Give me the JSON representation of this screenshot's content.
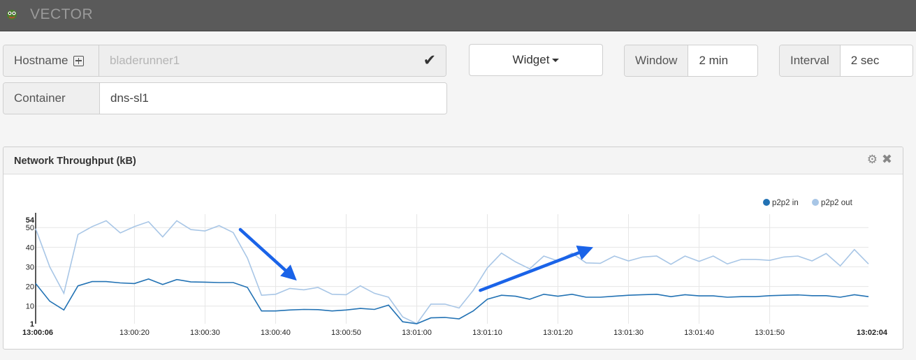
{
  "app": {
    "brand": "VECTOR",
    "logo_icon": "vector-logo-icon"
  },
  "hostname": {
    "label": "Hostname",
    "value": "bladerunner1",
    "add_icon": "plus-square-icon",
    "confirm_icon": "check-icon"
  },
  "container": {
    "label": "Container",
    "value": "dns-sl1"
  },
  "widget_button": {
    "label": "Widget"
  },
  "window": {
    "label": "Window",
    "value": "2 min"
  },
  "interval": {
    "label": "Interval",
    "value": "2 sec"
  },
  "panel": {
    "title": "Network Throughput (kB)",
    "settings_icon": "gear-icon",
    "close_icon": "close-icon"
  },
  "colors": {
    "in": "#2272b4",
    "out": "#a8c6e6",
    "arrow": "#1a63e8"
  },
  "chart_data": {
    "type": "line",
    "title": "Network Throughput (kB)",
    "x_start_label": "13:00:06",
    "x_end_label": "13:02:04",
    "x_tick_labels": [
      "13:00:20",
      "13:00:30",
      "13:00:40",
      "13:00:50",
      "13:01:00",
      "13:01:10",
      "13:01:20",
      "13:01:30",
      "13:01:40",
      "13:01:50"
    ],
    "y_tick_labels": [
      "1",
      "10",
      "20",
      "30",
      "40",
      "50",
      "54"
    ],
    "ylim": [
      1,
      54
    ],
    "grid": true,
    "legend_position": "top-right",
    "x": [
      "13:00:06",
      "13:00:08",
      "13:00:10",
      "13:00:12",
      "13:00:14",
      "13:00:16",
      "13:00:18",
      "13:00:20",
      "13:00:22",
      "13:00:24",
      "13:00:26",
      "13:00:28",
      "13:00:30",
      "13:00:32",
      "13:00:34",
      "13:00:36",
      "13:00:38",
      "13:00:40",
      "13:00:42",
      "13:00:44",
      "13:00:46",
      "13:00:48",
      "13:00:50",
      "13:00:52",
      "13:00:54",
      "13:00:56",
      "13:00:58",
      "13:01:00",
      "13:01:02",
      "13:01:04",
      "13:01:06",
      "13:01:08",
      "13:01:10",
      "13:01:12",
      "13:01:14",
      "13:01:16",
      "13:01:18",
      "13:01:20",
      "13:01:22",
      "13:01:24",
      "13:01:26",
      "13:01:28",
      "13:01:30",
      "13:01:32",
      "13:01:34",
      "13:01:36",
      "13:01:38",
      "13:01:40",
      "13:01:42",
      "13:01:44",
      "13:01:46",
      "13:01:48",
      "13:01:50",
      "13:01:52",
      "13:01:54",
      "13:01:56",
      "13:01:58",
      "13:02:00",
      "13:02:02",
      "13:02:04"
    ],
    "series": [
      {
        "name": "p2p2 in",
        "values": [
          21.5,
          12.5,
          8.0,
          20.3,
          22.5,
          22.5,
          21.8,
          21.5,
          23.8,
          21.0,
          23.5,
          22.3,
          22.2,
          22.0,
          22.0,
          19.5,
          7.5,
          7.5,
          8.0,
          8.3,
          8.2,
          7.5,
          8.0,
          8.8,
          8.3,
          10.5,
          2.0,
          1.0,
          4.0,
          4.2,
          3.5,
          7.5,
          13.5,
          15.5,
          15.0,
          13.5,
          16.0,
          15.0,
          16.0,
          14.5,
          14.5,
          15.0,
          15.5,
          15.8,
          16.0,
          14.8,
          15.8,
          15.2,
          15.2,
          14.5,
          14.8,
          14.8,
          15.3,
          15.5,
          15.7,
          15.3,
          15.3,
          14.5,
          15.8,
          14.8
        ]
      },
      {
        "name": "p2p2 out",
        "values": [
          49.5,
          30.0,
          16.5,
          46.5,
          50.5,
          53.5,
          47.3,
          50.5,
          53.0,
          45.3,
          53.5,
          49.0,
          48.3,
          51.0,
          47.5,
          34.5,
          15.5,
          16.0,
          19.0,
          18.3,
          19.5,
          16.0,
          15.8,
          20.3,
          16.5,
          14.5,
          4.5,
          1.0,
          11.0,
          11.0,
          9.0,
          18.0,
          29.5,
          37.0,
          32.5,
          29.0,
          35.5,
          33.0,
          37.0,
          32.0,
          31.8,
          35.5,
          33.0,
          35.0,
          35.5,
          31.3,
          35.5,
          32.8,
          35.5,
          31.5,
          33.8,
          33.8,
          33.3,
          35.0,
          35.5,
          33.0,
          36.8,
          30.5,
          38.8,
          31.5
        ]
      }
    ],
    "annotations": [
      {
        "type": "arrow",
        "direction": "down-right",
        "from": {
          "x": "13:00:35",
          "y": 49
        },
        "to": {
          "x": "13:00:43",
          "y": 23
        }
      },
      {
        "type": "arrow",
        "direction": "up-right",
        "from": {
          "x": "13:01:09",
          "y": 18
        },
        "to": {
          "x": "13:01:25",
          "y": 40
        }
      }
    ]
  }
}
